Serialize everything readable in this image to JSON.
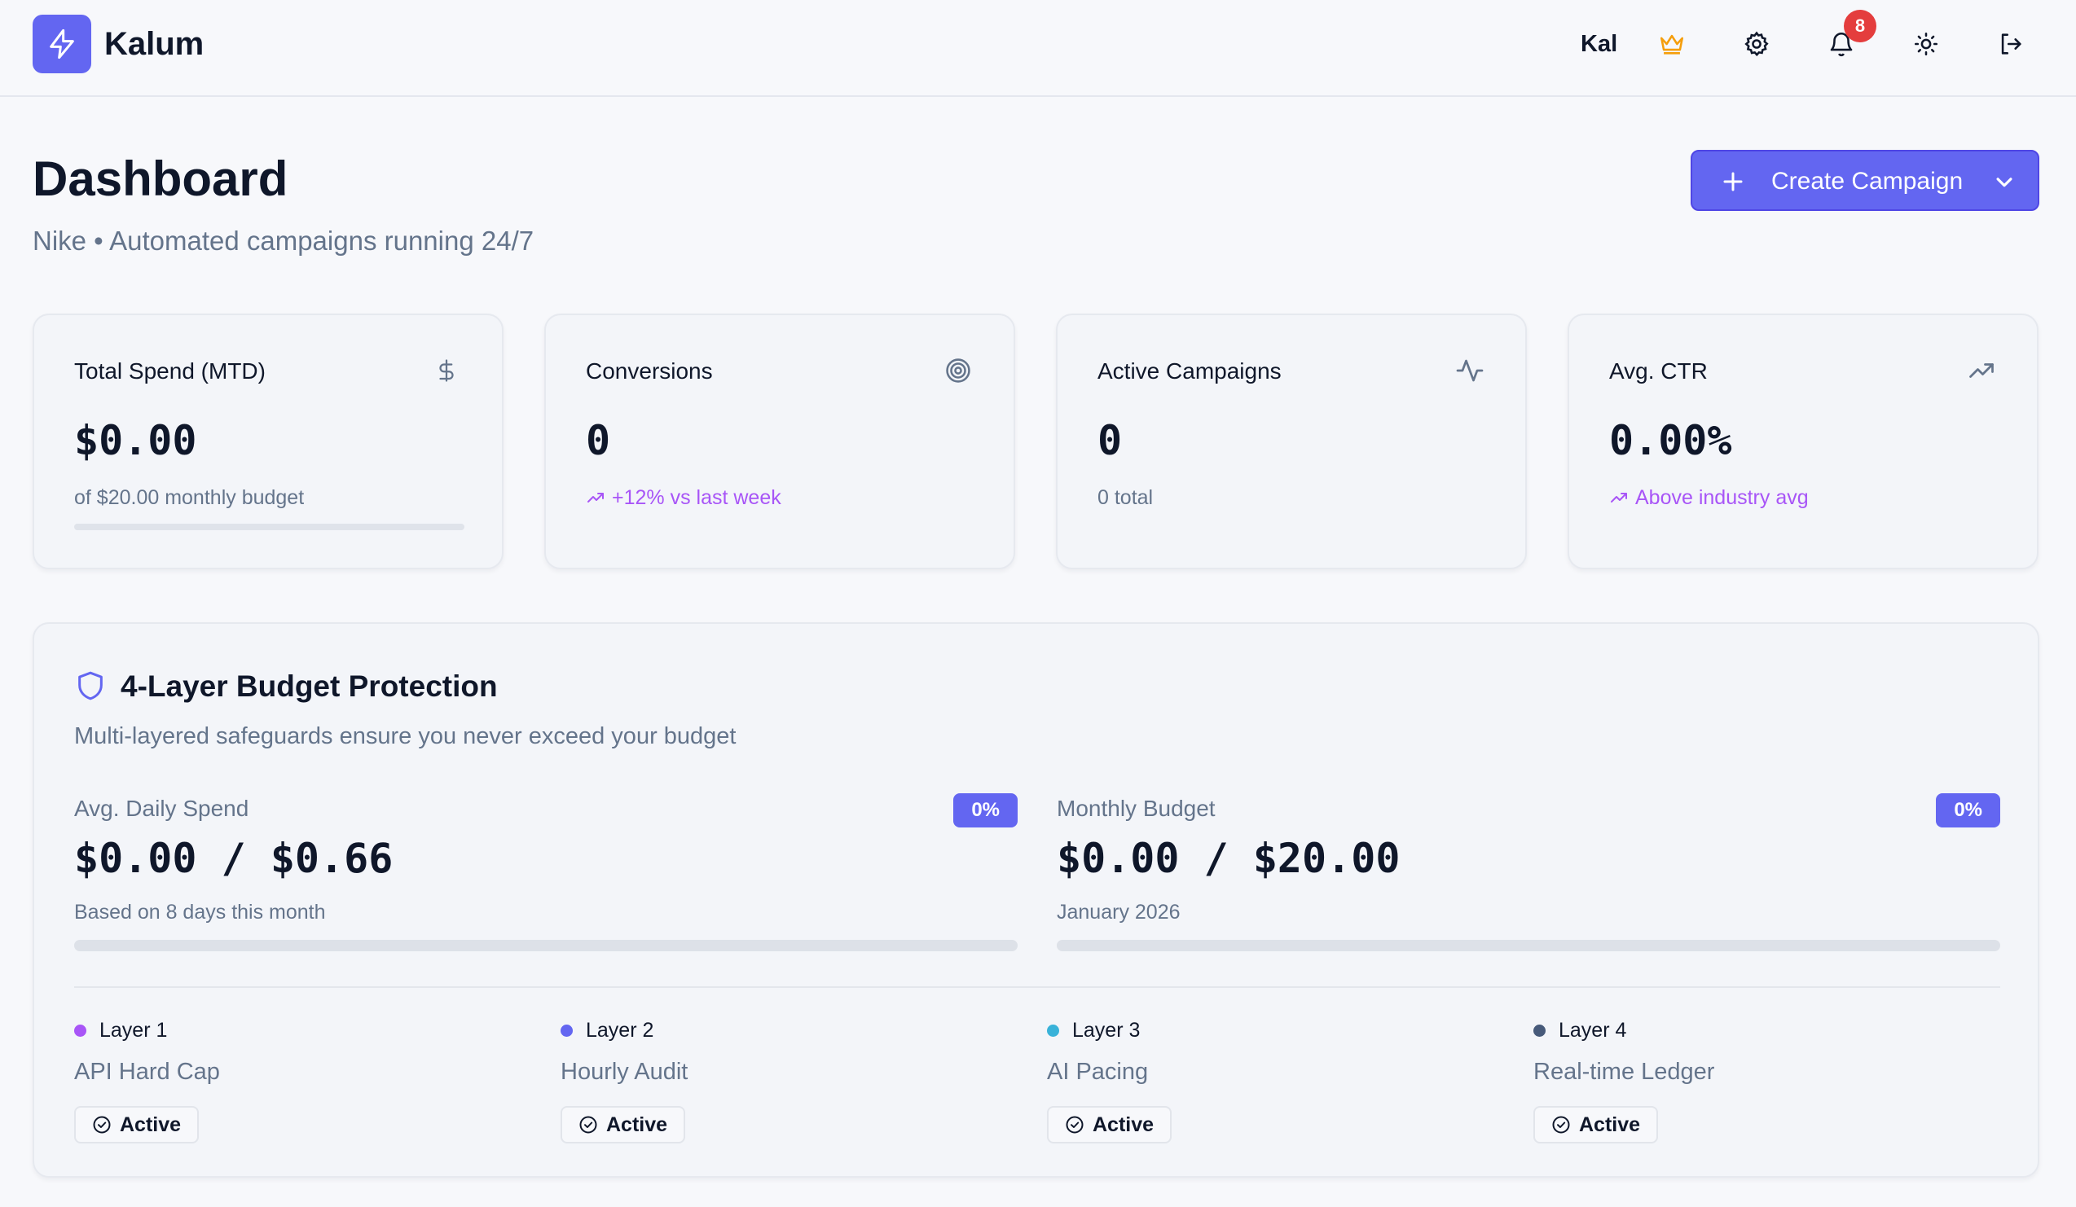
{
  "app": {
    "brand": "Kalum",
    "user": "Kal",
    "notification_count": "8"
  },
  "header": {
    "title": "Dashboard",
    "subtitle": "Nike • Automated campaigns running 24/7",
    "create_button": "Create Campaign"
  },
  "stats": [
    {
      "title": "Total Spend (MTD)",
      "value": "$0.00",
      "sub": "of $20.00 monthly budget",
      "icon": "dollar-icon",
      "progress": 0
    },
    {
      "title": "Conversions",
      "value": "0",
      "sub": "+12% vs last week",
      "icon": "target-icon"
    },
    {
      "title": "Active Campaigns",
      "value": "0",
      "sub": "0 total",
      "icon": "activity-icon"
    },
    {
      "title": "Avg. CTR",
      "value": "0.00%",
      "sub": "Above industry avg",
      "icon": "trending-up-icon"
    }
  ],
  "protection": {
    "title": "4-Layer Budget Protection",
    "description": "Multi-layered safeguards ensure you never exceed your budget",
    "daily": {
      "label": "Avg. Daily Spend",
      "percent": "0%",
      "value": "$0.00 / $0.66",
      "sub": "Based on 8 days this month",
      "progress": 0
    },
    "monthly": {
      "label": "Monthly Budget",
      "percent": "0%",
      "value": "$0.00 / $20.00",
      "sub": "January 2026",
      "progress": 0
    },
    "layers": [
      {
        "num": "Layer 1",
        "name": "API Hard Cap",
        "status": "Active",
        "color": "#a855f7"
      },
      {
        "num": "Layer 2",
        "name": "Hourly Audit",
        "status": "Active",
        "color": "#6366f1"
      },
      {
        "num": "Layer 3",
        "name": "AI Pacing",
        "status": "Active",
        "color": "#38b2d9"
      },
      {
        "num": "Layer 4",
        "name": "Real-time Ledger",
        "status": "Active",
        "color": "#475a7a"
      }
    ]
  },
  "colors": {
    "accent": "#6366f1",
    "positive": "#a855f7",
    "crown": "#f59e0b",
    "badge": "#e43d3d"
  }
}
